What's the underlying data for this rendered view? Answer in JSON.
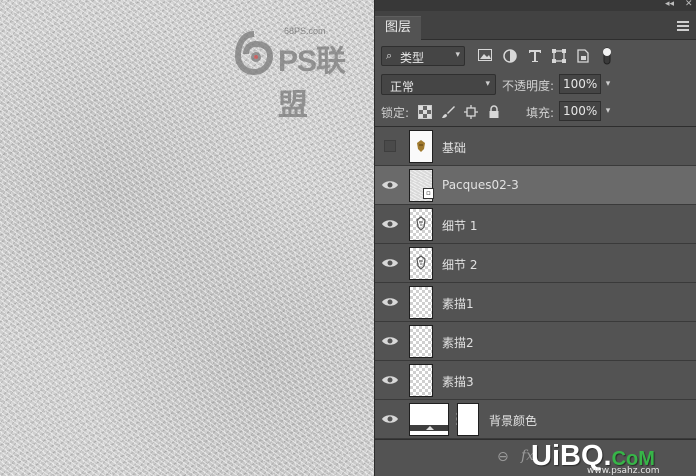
{
  "watermark": {
    "site": "68PS.com",
    "brand": "PS联盟"
  },
  "panel": {
    "tab_label": "图层",
    "filter": {
      "label": "类型"
    },
    "blend_mode": "正常",
    "opacity_label": "不透明度:",
    "opacity_value": "100%",
    "lock_label": "锁定:",
    "fill_label": "填充:",
    "fill_value": "100%"
  },
  "layers": [
    {
      "name": "基础",
      "visible": false,
      "selected": false,
      "thumb": "sketch-color"
    },
    {
      "name": "Pacques02-3",
      "visible": true,
      "selected": true,
      "thumb": "smart-object"
    },
    {
      "name": "细节 1",
      "visible": true,
      "selected": false,
      "thumb": "sketch"
    },
    {
      "name": "细节 2",
      "visible": true,
      "selected": false,
      "thumb": "sketch"
    },
    {
      "name": "素描1",
      "visible": true,
      "selected": false,
      "thumb": "transparent"
    },
    {
      "name": "素描2",
      "visible": true,
      "selected": false,
      "thumb": "transparent"
    },
    {
      "name": "素描3",
      "visible": true,
      "selected": false,
      "thumb": "transparent"
    },
    {
      "name": "背景颜色",
      "visible": true,
      "selected": false,
      "thumb": "fill-layer"
    }
  ],
  "bottom": {
    "fx": "fx",
    "wm_main": "UiBQ",
    "wm_dot": ".",
    "wm_com": "CoM",
    "wm_sub": "www.psahz.com"
  }
}
